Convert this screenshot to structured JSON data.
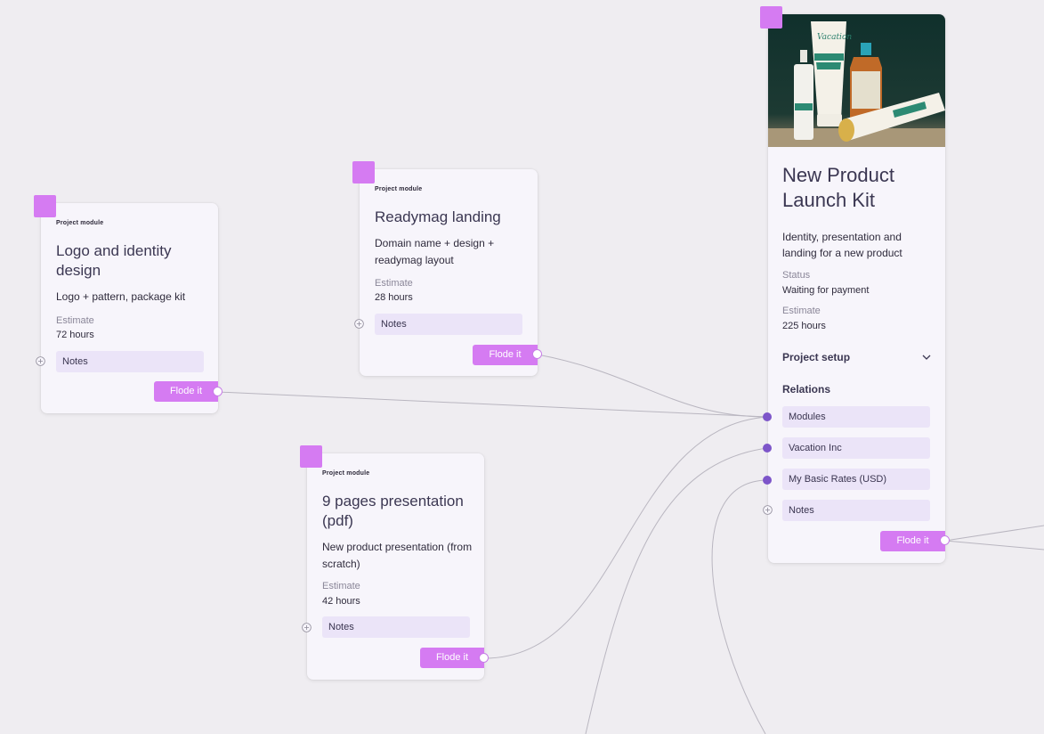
{
  "card_logo": {
    "kind": "Project module",
    "title_line1": "Logo and identity",
    "title_line2": "design",
    "desc": "Logo + pattern,  package kit",
    "estimate_label": "Estimate",
    "estimate_value": "72 hours",
    "notes_label": "Notes",
    "button_label": "Flode it"
  },
  "card_readymag": {
    "kind": "Project module",
    "title": "Readymag landing",
    "desc_line1": "Domain name + design +",
    "desc_line2": "readymag layout",
    "estimate_label": "Estimate",
    "estimate_value": "28 hours",
    "notes_label": "Notes",
    "button_label": "Flode it"
  },
  "card_presentation": {
    "kind": "Project module",
    "title_line1": "9 pages presentation",
    "title_line2": "(pdf)",
    "desc_line1": "New product presentation (from",
    "desc_line2": "scratch)",
    "estimate_label": "Estimate",
    "estimate_value": "42 hours",
    "notes_label": "Notes",
    "button_label": "Flode it"
  },
  "card_project": {
    "title_line1": "New Product",
    "title_line2": "Launch Kit",
    "desc_line1": "Identity, presentation and",
    "desc_line2": "landing for a new product",
    "status_label": "Status",
    "status_value": "Waiting for payment",
    "estimate_label": "Estimate",
    "estimate_value": "225 hours",
    "setup_label": "Project setup",
    "relations_label": "Relations",
    "relations": [
      "Modules",
      "Vacation Inc",
      "My Basic Rates (USD)"
    ],
    "notes_label": "Notes",
    "button_label": "Flode it",
    "image_text": "Vacation"
  },
  "colors": {
    "accent": "#d57bf2",
    "relation_dot": "#7d55c9",
    "field_bg": "#ebe4f8",
    "canvas_bg": "#efedf1"
  }
}
